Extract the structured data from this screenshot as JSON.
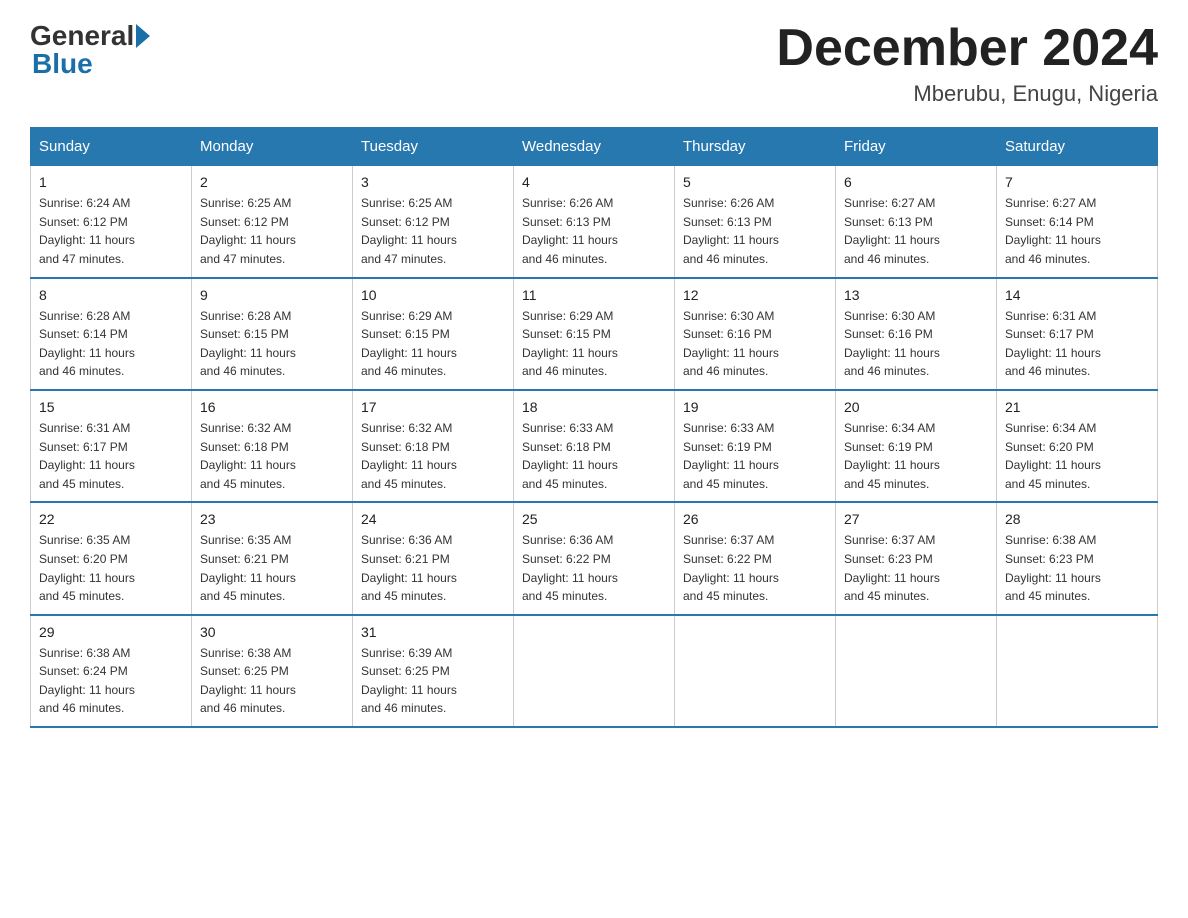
{
  "logo": {
    "general": "General",
    "blue": "Blue"
  },
  "header": {
    "title": "December 2024",
    "location": "Mberubu, Enugu, Nigeria"
  },
  "days_of_week": [
    "Sunday",
    "Monday",
    "Tuesday",
    "Wednesday",
    "Thursday",
    "Friday",
    "Saturday"
  ],
  "weeks": [
    [
      {
        "day": "1",
        "sunrise": "6:24 AM",
        "sunset": "6:12 PM",
        "daylight": "11 hours and 47 minutes."
      },
      {
        "day": "2",
        "sunrise": "6:25 AM",
        "sunset": "6:12 PM",
        "daylight": "11 hours and 47 minutes."
      },
      {
        "day": "3",
        "sunrise": "6:25 AM",
        "sunset": "6:12 PM",
        "daylight": "11 hours and 47 minutes."
      },
      {
        "day": "4",
        "sunrise": "6:26 AM",
        "sunset": "6:13 PM",
        "daylight": "11 hours and 46 minutes."
      },
      {
        "day": "5",
        "sunrise": "6:26 AM",
        "sunset": "6:13 PM",
        "daylight": "11 hours and 46 minutes."
      },
      {
        "day": "6",
        "sunrise": "6:27 AM",
        "sunset": "6:13 PM",
        "daylight": "11 hours and 46 minutes."
      },
      {
        "day": "7",
        "sunrise": "6:27 AM",
        "sunset": "6:14 PM",
        "daylight": "11 hours and 46 minutes."
      }
    ],
    [
      {
        "day": "8",
        "sunrise": "6:28 AM",
        "sunset": "6:14 PM",
        "daylight": "11 hours and 46 minutes."
      },
      {
        "day": "9",
        "sunrise": "6:28 AM",
        "sunset": "6:15 PM",
        "daylight": "11 hours and 46 minutes."
      },
      {
        "day": "10",
        "sunrise": "6:29 AM",
        "sunset": "6:15 PM",
        "daylight": "11 hours and 46 minutes."
      },
      {
        "day": "11",
        "sunrise": "6:29 AM",
        "sunset": "6:15 PM",
        "daylight": "11 hours and 46 minutes."
      },
      {
        "day": "12",
        "sunrise": "6:30 AM",
        "sunset": "6:16 PM",
        "daylight": "11 hours and 46 minutes."
      },
      {
        "day": "13",
        "sunrise": "6:30 AM",
        "sunset": "6:16 PM",
        "daylight": "11 hours and 46 minutes."
      },
      {
        "day": "14",
        "sunrise": "6:31 AM",
        "sunset": "6:17 PM",
        "daylight": "11 hours and 46 minutes."
      }
    ],
    [
      {
        "day": "15",
        "sunrise": "6:31 AM",
        "sunset": "6:17 PM",
        "daylight": "11 hours and 45 minutes."
      },
      {
        "day": "16",
        "sunrise": "6:32 AM",
        "sunset": "6:18 PM",
        "daylight": "11 hours and 45 minutes."
      },
      {
        "day": "17",
        "sunrise": "6:32 AM",
        "sunset": "6:18 PM",
        "daylight": "11 hours and 45 minutes."
      },
      {
        "day": "18",
        "sunrise": "6:33 AM",
        "sunset": "6:18 PM",
        "daylight": "11 hours and 45 minutes."
      },
      {
        "day": "19",
        "sunrise": "6:33 AM",
        "sunset": "6:19 PM",
        "daylight": "11 hours and 45 minutes."
      },
      {
        "day": "20",
        "sunrise": "6:34 AM",
        "sunset": "6:19 PM",
        "daylight": "11 hours and 45 minutes."
      },
      {
        "day": "21",
        "sunrise": "6:34 AM",
        "sunset": "6:20 PM",
        "daylight": "11 hours and 45 minutes."
      }
    ],
    [
      {
        "day": "22",
        "sunrise": "6:35 AM",
        "sunset": "6:20 PM",
        "daylight": "11 hours and 45 minutes."
      },
      {
        "day": "23",
        "sunrise": "6:35 AM",
        "sunset": "6:21 PM",
        "daylight": "11 hours and 45 minutes."
      },
      {
        "day": "24",
        "sunrise": "6:36 AM",
        "sunset": "6:21 PM",
        "daylight": "11 hours and 45 minutes."
      },
      {
        "day": "25",
        "sunrise": "6:36 AM",
        "sunset": "6:22 PM",
        "daylight": "11 hours and 45 minutes."
      },
      {
        "day": "26",
        "sunrise": "6:37 AM",
        "sunset": "6:22 PM",
        "daylight": "11 hours and 45 minutes."
      },
      {
        "day": "27",
        "sunrise": "6:37 AM",
        "sunset": "6:23 PM",
        "daylight": "11 hours and 45 minutes."
      },
      {
        "day": "28",
        "sunrise": "6:38 AM",
        "sunset": "6:23 PM",
        "daylight": "11 hours and 45 minutes."
      }
    ],
    [
      {
        "day": "29",
        "sunrise": "6:38 AM",
        "sunset": "6:24 PM",
        "daylight": "11 hours and 46 minutes."
      },
      {
        "day": "30",
        "sunrise": "6:38 AM",
        "sunset": "6:25 PM",
        "daylight": "11 hours and 46 minutes."
      },
      {
        "day": "31",
        "sunrise": "6:39 AM",
        "sunset": "6:25 PM",
        "daylight": "11 hours and 46 minutes."
      },
      null,
      null,
      null,
      null
    ]
  ],
  "labels": {
    "sunrise": "Sunrise:",
    "sunset": "Sunset:",
    "daylight": "Daylight:"
  }
}
